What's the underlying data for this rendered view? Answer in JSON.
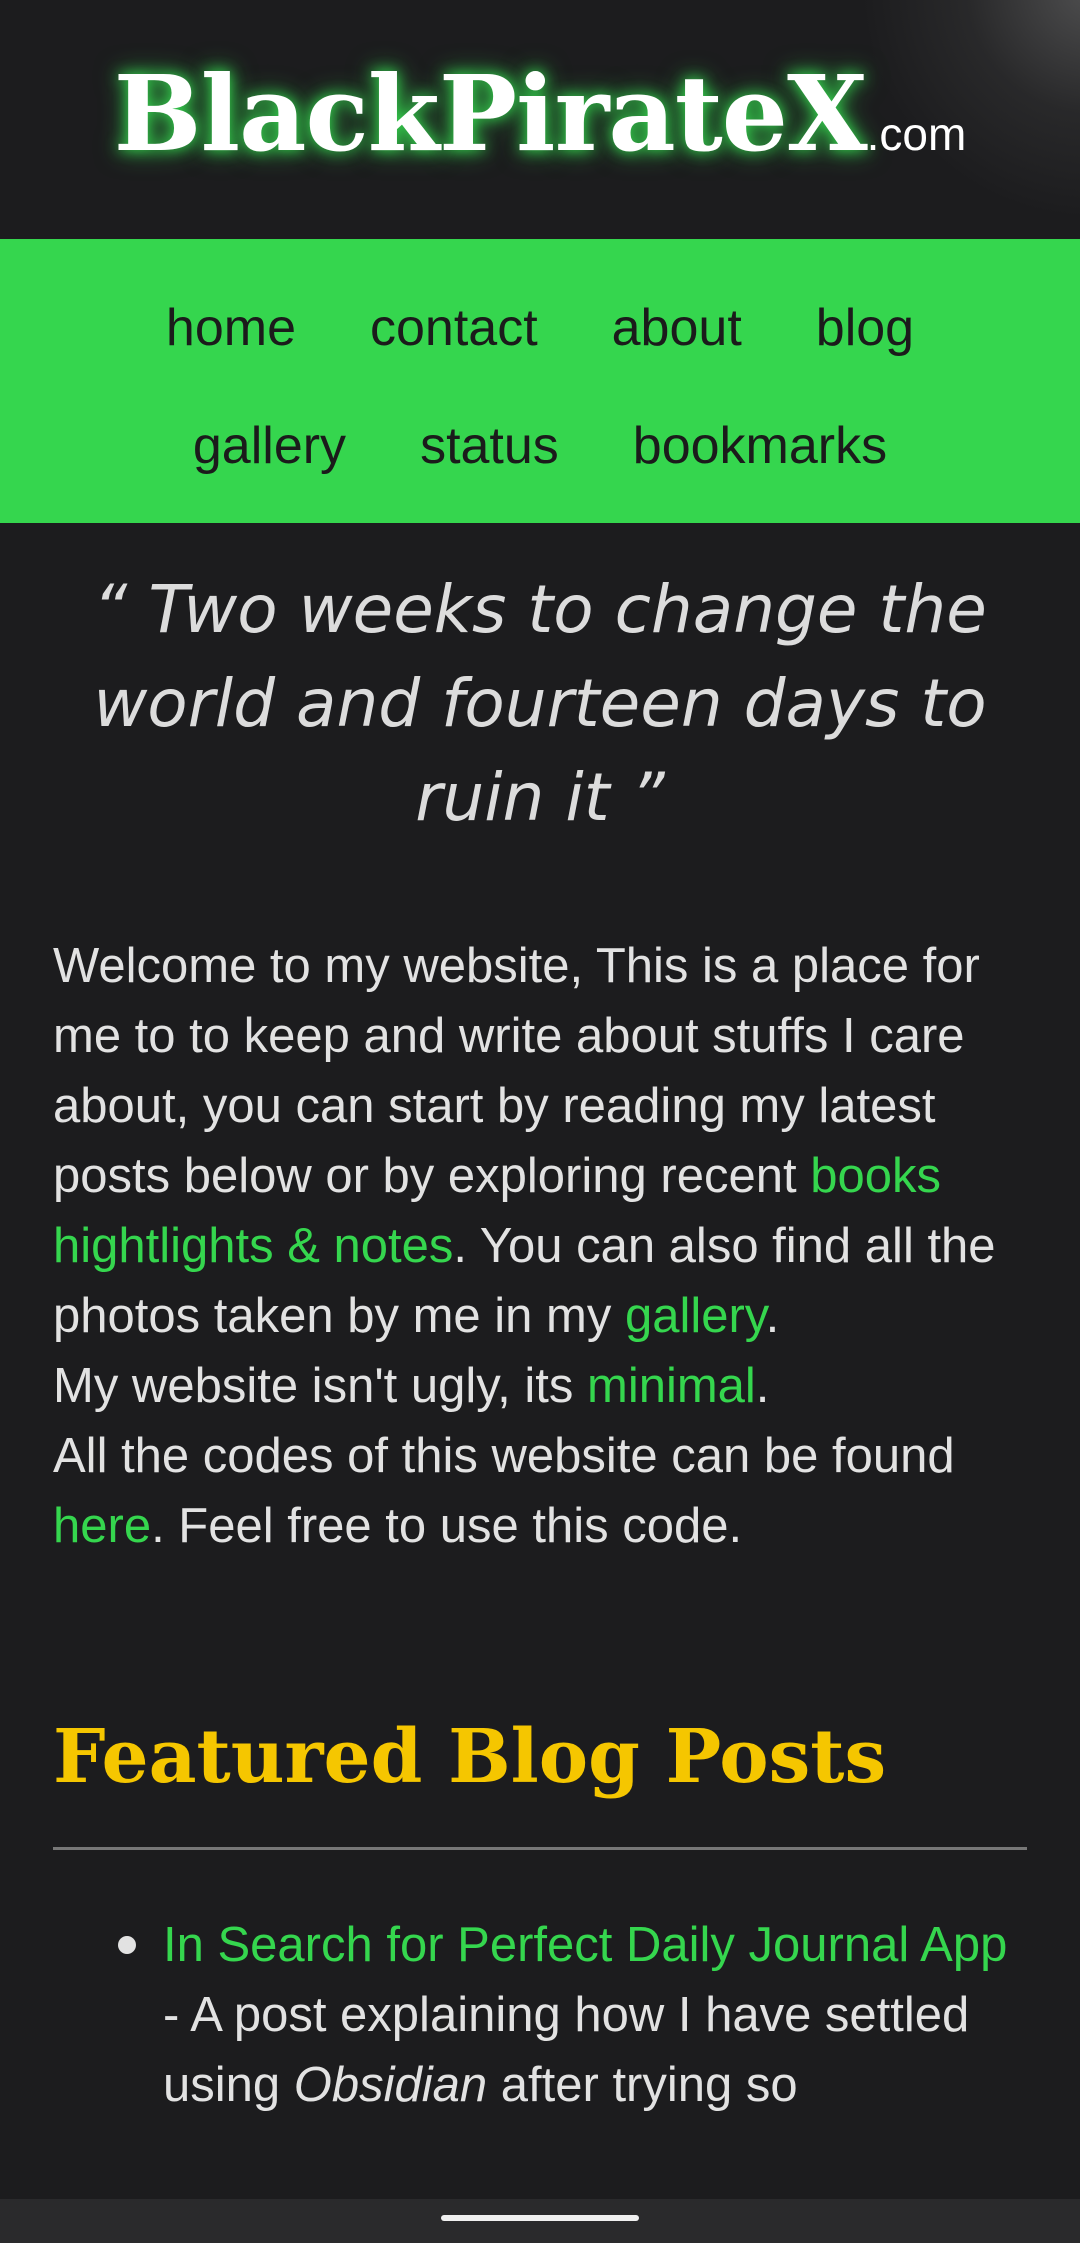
{
  "site": {
    "name": "BlackPirateX",
    "tld": ".com"
  },
  "nav": {
    "row1": [
      "home",
      "contact",
      "about",
      "blog"
    ],
    "row2": [
      "gallery",
      "status",
      "bookmarks"
    ]
  },
  "quote": "“ Two weeks to change the world and fourteen days to ruin it ”",
  "intro": {
    "p1_start": "Welcome to my website, This is a place for me to to keep and write about stuffs I care about, you can start by reading my latest posts below or by exploring recent ",
    "books_link": "books hightlights & notes",
    "p1_mid": ". You can also find all the photos taken by me in my ",
    "gallery_link": "gallery",
    "p1_end": ".",
    "p2_start": "My website isn't ugly, its ",
    "minimal_link": "minimal",
    "p2_end": ".",
    "p3_start": "All the codes of this website can be found ",
    "here_link": "here",
    "p3_end": ". Feel free to use this code."
  },
  "featured": {
    "title": "Featured Blog Posts",
    "posts": [
      {
        "link": "In Search for Perfect Daily Journal App",
        "desc_start": " - A post explaining how I have settled using ",
        "desc_em": "Obsidian",
        "desc_end": " after trying so"
      }
    ]
  },
  "colors": {
    "accent": "#35d64e",
    "heading": "#f5c600",
    "background": "#1c1c1e"
  }
}
